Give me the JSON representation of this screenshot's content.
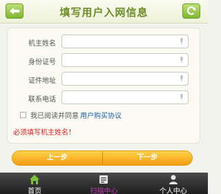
{
  "header": {
    "title": "填写用户入网信息",
    "back_icon": "back-arrow-icon",
    "refresh_icon": "refresh-icon"
  },
  "form": {
    "fields": [
      {
        "label": "机主姓名",
        "value": "",
        "placeholder": ""
      },
      {
        "label": "身份证号",
        "value": "",
        "placeholder": ""
      },
      {
        "label": "证件地址",
        "value": "",
        "placeholder": ""
      },
      {
        "label": "联系电话",
        "value": "",
        "placeholder": ""
      }
    ],
    "mic_icon": "microphone-icon",
    "agree_text": "我已阅读并同意",
    "agree_link": "用户购买协议",
    "agree_checked": false,
    "error": "必须填写机主姓名！"
  },
  "steps": {
    "prev": "上一步",
    "next": "下一步"
  },
  "nav": {
    "items": [
      {
        "label": "首页",
        "icon": "home-icon"
      },
      {
        "label": "扫描中心",
        "icon": "scan-icon"
      },
      {
        "label": "个人中心",
        "icon": "user-icon"
      }
    ],
    "active_index": 1
  },
  "colors": {
    "title": "#6d8d2a",
    "error": "#e22020",
    "link": "#1b5fa8",
    "step_button": "#f29b12",
    "nav_active": "#c23fb6"
  }
}
